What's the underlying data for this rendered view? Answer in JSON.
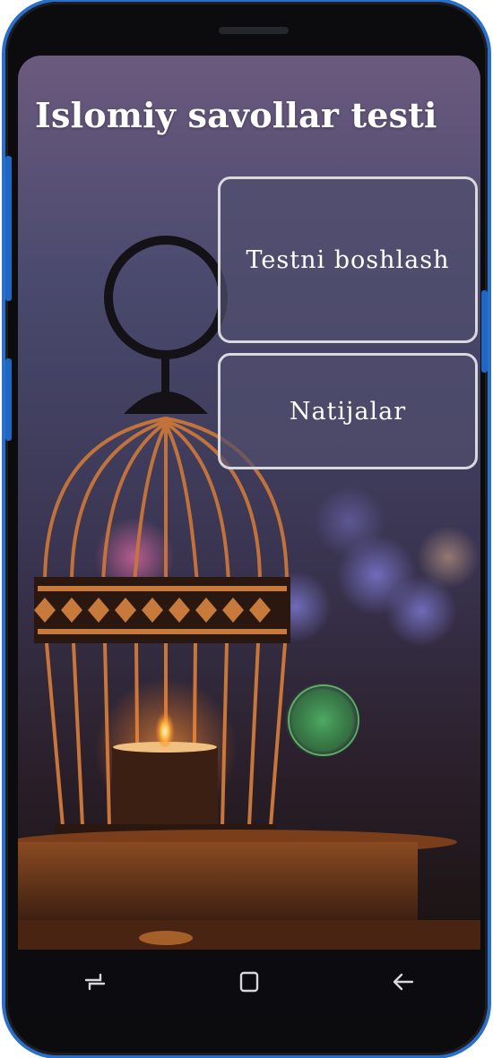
{
  "app": {
    "title": "Islomiy savollar testi"
  },
  "menu": {
    "start_label": "Testni boshlash",
    "results_label": "Natijalar"
  },
  "navbar": {
    "keys": [
      "recent-apps",
      "home",
      "back"
    ]
  },
  "colors": {
    "phone_frame": "#0c0c0e",
    "phone_trim": "#2a6fc9",
    "button_border": "#d8d8dd",
    "button_fill": "#504e6e"
  }
}
